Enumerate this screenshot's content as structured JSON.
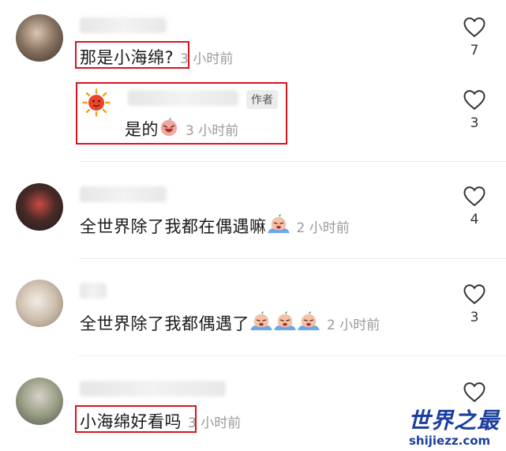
{
  "comments": [
    {
      "text": "那是小海绵?",
      "time": "3 小时前",
      "likes": "7"
    },
    {
      "text": "是的",
      "time": "3 小时前",
      "likes": "3",
      "badge": "作者"
    },
    {
      "text": "全世界除了我都在偶遇嘛",
      "time": "2 小时前",
      "likes": "4"
    },
    {
      "text": "全世界除了我都偶遇了",
      "time": "2 小时前",
      "likes": "3"
    },
    {
      "text": "小海绵好看吗",
      "time": "3 小时前",
      "likes": ""
    }
  ],
  "watermark": {
    "title": "世界之最",
    "url": "shijiezz.com"
  },
  "colors": {
    "highlight": "#d9141e",
    "watermark": "#1c3f9e",
    "time": "#9a9a9a"
  },
  "icons": {
    "like": "heart-outline-icon"
  }
}
